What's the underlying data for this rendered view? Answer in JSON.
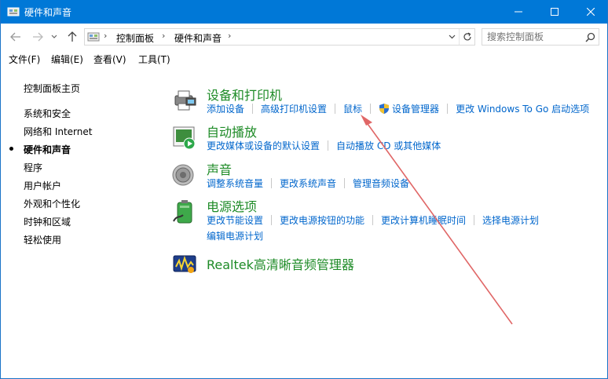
{
  "window": {
    "title": "硬件和声音",
    "icon": "control-panel-icon"
  },
  "nav": {
    "breadcrumb": [
      "控制面板",
      "硬件和声音"
    ],
    "search_placeholder": "搜索控制面板"
  },
  "menu": [
    "文件(F)",
    "编辑(E)",
    "查看(V)",
    "工具(T)"
  ],
  "sidebar": {
    "home": "控制面板主页",
    "items": [
      "系统和安全",
      "网络和 Internet",
      "硬件和声音",
      "程序",
      "用户帐户",
      "外观和个性化",
      "时钟和区域",
      "轻松使用"
    ],
    "active_index": 2
  },
  "categories": [
    {
      "title": "设备和打印机",
      "icon": "printer-icon",
      "links": [
        "添加设备",
        "高级打印机设置",
        "鼠标",
        "设备管理器",
        "更改 Windows To Go 启动选项"
      ]
    },
    {
      "title": "自动播放",
      "icon": "autoplay-icon",
      "links": [
        "更改媒体或设备的默认设置",
        "自动播放 CD 或其他媒体"
      ]
    },
    {
      "title": "声音",
      "icon": "speaker-icon",
      "links": [
        "调整系统音量",
        "更改系统声音",
        "管理音频设备"
      ]
    },
    {
      "title": "电源选项",
      "icon": "battery-icon",
      "links": [
        "更改节能设置",
        "更改电源按钮的功能",
        "更改计算机睡眠时间",
        "选择电源计划"
      ],
      "links2": [
        "编辑电源计划"
      ]
    },
    {
      "title": "Realtek高清晰音频管理器",
      "icon": "realtek-audio-icon",
      "links": []
    }
  ],
  "colors": {
    "titlebar": "#0078d7",
    "category_title": "#1e8b27",
    "link": "#0066cc",
    "annotation_arrow": "#e06666"
  }
}
